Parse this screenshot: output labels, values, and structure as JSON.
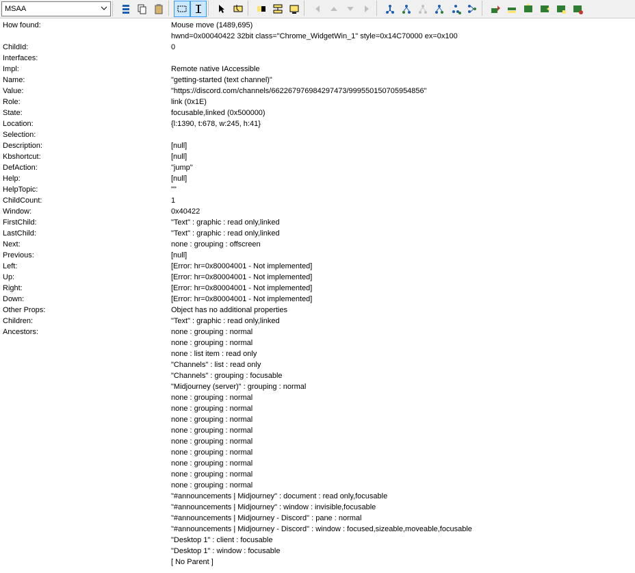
{
  "toolbar": {
    "mode_label": "MSAA",
    "buttons": [
      {
        "name": "tree-icon",
        "title": "Tree"
      },
      {
        "name": "copy-icon",
        "title": "Copy"
      },
      {
        "name": "paste-icon",
        "title": "Paste"
      },
      {
        "name": "rect-icon",
        "title": "Highlight Rect",
        "active": true
      },
      {
        "name": "caret-icon",
        "title": "Caret",
        "active": true
      },
      {
        "name": "pointer-icon",
        "title": "Pointer"
      },
      {
        "name": "focus-rect-icon",
        "title": "Focus"
      },
      {
        "name": "contrast-icon",
        "title": "Contrast"
      },
      {
        "name": "collapse-icon",
        "title": "Collapse"
      },
      {
        "name": "desktop-icon",
        "title": "Desktop"
      },
      {
        "name": "nav-left-icon",
        "title": "Back",
        "disabled": true
      },
      {
        "name": "nav-up-icon",
        "title": "Up",
        "disabled": true
      },
      {
        "name": "nav-down-icon",
        "title": "Down",
        "disabled": true
      },
      {
        "name": "nav-right-icon",
        "title": "Forward",
        "disabled": true
      },
      {
        "name": "parent-icon",
        "title": "Parent"
      },
      {
        "name": "first-child-icon",
        "title": "First Child"
      },
      {
        "name": "prev-sibling-icon",
        "title": "Prev Sibling",
        "disabled": true
      },
      {
        "name": "next-sibling-icon",
        "title": "Next Sibling"
      },
      {
        "name": "last-child-icon",
        "title": "Last Child"
      },
      {
        "name": "tree-alt-icon",
        "title": "Tree View"
      },
      {
        "name": "action1-icon",
        "title": "Action 1"
      },
      {
        "name": "action2-icon",
        "title": "Action 2"
      },
      {
        "name": "action3-icon",
        "title": "Action 3"
      },
      {
        "name": "action4-icon",
        "title": "Action 4"
      },
      {
        "name": "action5-icon",
        "title": "Action 5"
      },
      {
        "name": "action6-icon",
        "title": "Action 6"
      }
    ]
  },
  "props": {
    "rows": [
      {
        "label": "How found:",
        "value": "Mouse move (1489,695)"
      },
      {
        "label": "",
        "value": "hwnd=0x00040422 32bit class=\"Chrome_WidgetWin_1\" style=0x14C70000 ex=0x100"
      },
      {
        "label": "ChildId:",
        "value": "0"
      },
      {
        "label": "Interfaces:",
        "value": ""
      },
      {
        "label": "Impl:",
        "value": "Remote native IAccessible"
      },
      {
        "label": "Name:",
        "value": "\"getting-started (text channel)\""
      },
      {
        "label": "Value:",
        "value": "\"https://discord.com/channels/662267976984297473/999550150705954856\""
      },
      {
        "label": "Role:",
        "value": "link (0x1E)"
      },
      {
        "label": "State:",
        "value": "focusable,linked (0x500000)"
      },
      {
        "label": "Location:",
        "value": "{l:1390, t:678, w:245, h:41}"
      },
      {
        "label": "Selection:",
        "value": ""
      },
      {
        "label": "Description:",
        "value": "[null]"
      },
      {
        "label": "Kbshortcut:",
        "value": "[null]"
      },
      {
        "label": "DefAction:",
        "value": "\"jump\""
      },
      {
        "label": "Help:",
        "value": "[null]"
      },
      {
        "label": "HelpTopic:",
        "value": "\"\""
      },
      {
        "label": "ChildCount:",
        "value": "1"
      },
      {
        "label": "Window:",
        "value": "0x40422"
      },
      {
        "label": "FirstChild:",
        "value": "\"Text\" : graphic : read only,linked"
      },
      {
        "label": "LastChild:",
        "value": "\"Text\" : graphic : read only,linked"
      },
      {
        "label": "Next:",
        "value": "none : grouping : offscreen"
      },
      {
        "label": "Previous:",
        "value": "[null]"
      },
      {
        "label": "Left:",
        "value": "[Error: hr=0x80004001 - Not implemented]"
      },
      {
        "label": "Up:",
        "value": "[Error: hr=0x80004001 - Not implemented]"
      },
      {
        "label": "Right:",
        "value": "[Error: hr=0x80004001 - Not implemented]"
      },
      {
        "label": "Down:",
        "value": "[Error: hr=0x80004001 - Not implemented]"
      },
      {
        "label": "Other Props:",
        "value": "Object has no additional properties"
      },
      {
        "label": "Children:",
        "value": "\"Text\" : graphic : read only,linked"
      },
      {
        "label": "Ancestors:",
        "value": "none : grouping : normal"
      }
    ],
    "ancestors_extra": [
      "none : grouping : normal",
      "none : list item : read only",
      "\"Channels\" : list : read only",
      "\"Channels\" : grouping : focusable",
      "\"Midjourney (server)\" : grouping : normal",
      "none : grouping : normal",
      "none : grouping : normal",
      "none : grouping : normal",
      "none : grouping : normal",
      "none : grouping : normal",
      "none : grouping : normal",
      "none : grouping : normal",
      "none : grouping : normal",
      "none : grouping : normal",
      "\"#announcements | Midjourney\" : document : read only,focusable",
      "\"#announcements | Midjourney\" : window : invisible,focusable",
      "\"#announcements | Midjourney - Discord\" : pane : normal",
      "\"#announcements | Midjourney - Discord\" : window : focused,sizeable,moveable,focusable",
      "\"Desktop 1\" : client : focusable",
      "\"Desktop 1\" : window : focusable",
      "[ No Parent ]"
    ]
  }
}
